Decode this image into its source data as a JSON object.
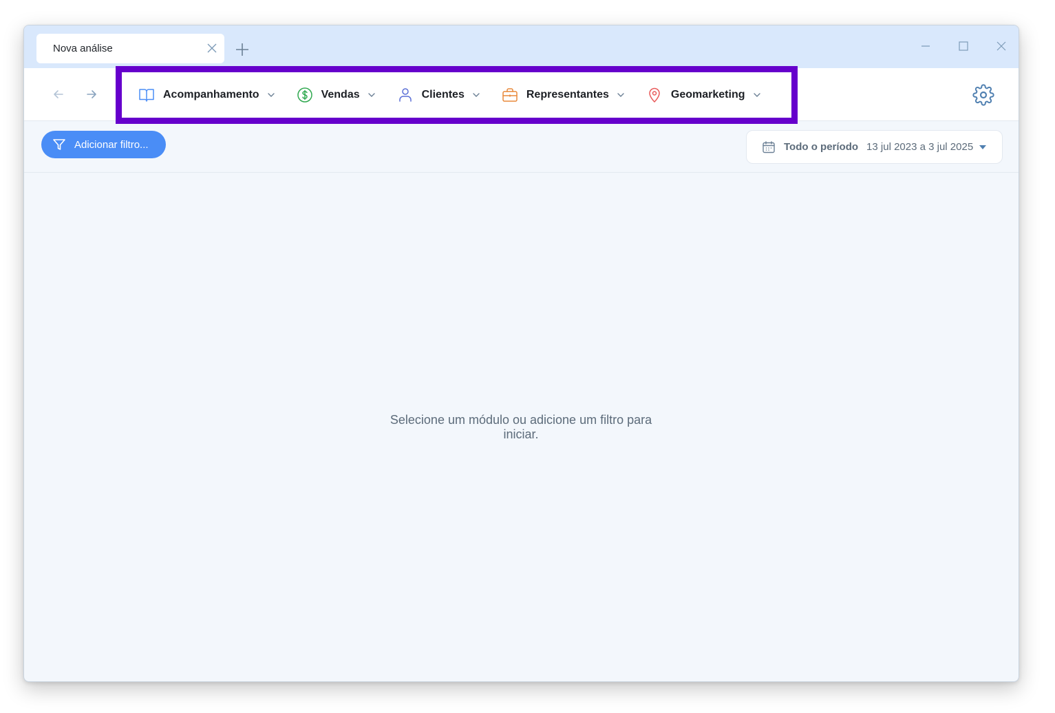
{
  "tab": {
    "title": "Nova análise"
  },
  "modules": [
    {
      "label": "Acompanhamento",
      "icon": "book-icon",
      "color": "#4a8df6"
    },
    {
      "label": "Vendas",
      "icon": "dollar-circle-icon",
      "color": "#2fa84f"
    },
    {
      "label": "Clientes",
      "icon": "user-icon",
      "color": "#5b6fd6"
    },
    {
      "label": "Representantes",
      "icon": "briefcase-icon",
      "color": "#e8893a"
    },
    {
      "label": "Geomarketing",
      "icon": "map-pin-icon",
      "color": "#e85a5a"
    }
  ],
  "filter": {
    "add_label": "Adicionar filtro..."
  },
  "period": {
    "label": "Todo o período",
    "range": "13 jul 2023 a 3 jul 2025"
  },
  "main": {
    "empty_message": "Selecione um módulo ou adicione um filtro para iniciar."
  },
  "colors": {
    "highlight_box": "#6600cc",
    "accent": "#4a8df6",
    "titlebar": "#d9e8fc"
  }
}
